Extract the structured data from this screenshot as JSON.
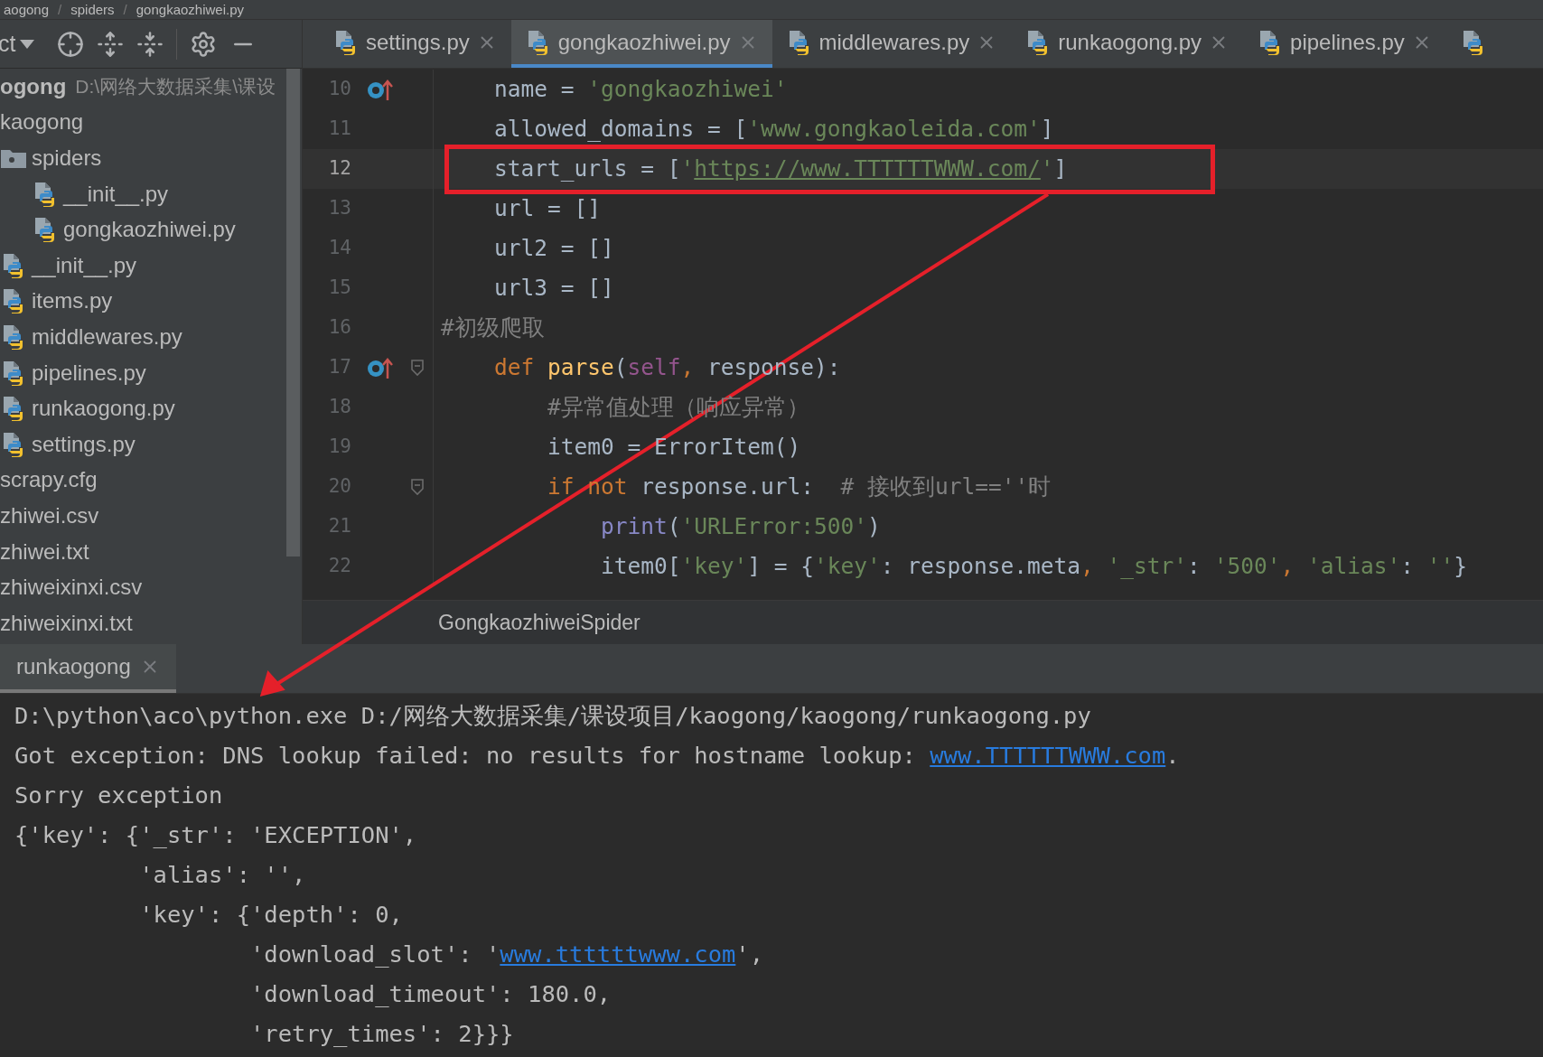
{
  "breadcrumb": {
    "separator": "/",
    "items": [
      "aogong",
      "spiders",
      "gongkaozhiwei.py"
    ]
  },
  "project_panel": {
    "view_label": "ct",
    "root": {
      "name": "ogong",
      "path": "D:\\网络大数据采集\\课设"
    },
    "tree": [
      {
        "name": "kaogong",
        "children": [
          {
            "name": "spiders",
            "kind": "folder",
            "children": [
              {
                "name": "__init__.py",
                "kind": "python"
              },
              {
                "name": "gongkaozhiwei.py",
                "kind": "python"
              }
            ]
          },
          {
            "name": "__init__.py",
            "kind": "python"
          },
          {
            "name": "items.py",
            "kind": "python"
          },
          {
            "name": "middlewares.py",
            "kind": "python"
          },
          {
            "name": "pipelines.py",
            "kind": "python"
          },
          {
            "name": "runkaogong.py",
            "kind": "python"
          },
          {
            "name": "settings.py",
            "kind": "python"
          }
        ]
      },
      {
        "name": "scrapy.cfg"
      },
      {
        "name": "zhiwei.csv"
      },
      {
        "name": "zhiwei.txt"
      },
      {
        "name": "zhiweixinxi.csv"
      },
      {
        "name": "zhiweixinxi.txt"
      }
    ]
  },
  "tabs": [
    {
      "label": "settings.py",
      "selected": false
    },
    {
      "label": "gongkaozhiwei.py",
      "selected": true
    },
    {
      "label": "middlewares.py",
      "selected": false
    },
    {
      "label": "runkaogong.py",
      "selected": false
    },
    {
      "label": "pipelines.py",
      "selected": false
    }
  ],
  "editor": {
    "lines": [
      {
        "number": "10",
        "current": false,
        "override": true,
        "fold": false,
        "tokens": [
          {
            "kind": "plain",
            "text": "    name = "
          },
          {
            "kind": "string",
            "text": "'gongkaozhiwei'"
          }
        ]
      },
      {
        "number": "11",
        "current": false,
        "override": false,
        "fold": false,
        "tokens": [
          {
            "kind": "plain",
            "text": "    allowed_domains = ["
          },
          {
            "kind": "string",
            "text": "'www.gongkaoleida.com'"
          },
          {
            "kind": "plain",
            "text": "]"
          }
        ]
      },
      {
        "number": "12",
        "current": true,
        "override": false,
        "fold": false,
        "tokens": [
          {
            "kind": "plain",
            "text": "    start_urls = ["
          },
          {
            "kind": "string",
            "text": "'"
          },
          {
            "kind": "url",
            "text": "https://www.TTTTTTWWW.com/"
          },
          {
            "kind": "string",
            "text": "'"
          },
          {
            "kind": "plain",
            "text": "]"
          }
        ]
      },
      {
        "number": "13",
        "current": false,
        "override": false,
        "fold": false,
        "tokens": [
          {
            "kind": "plain",
            "text": "    url = []"
          }
        ]
      },
      {
        "number": "14",
        "current": false,
        "override": false,
        "fold": false,
        "tokens": [
          {
            "kind": "plain",
            "text": "    url2 = []"
          }
        ]
      },
      {
        "number": "15",
        "current": false,
        "override": false,
        "fold": false,
        "tokens": [
          {
            "kind": "plain",
            "text": "    url3 = []"
          }
        ]
      },
      {
        "number": "16",
        "current": false,
        "override": false,
        "fold": false,
        "tokens": [
          {
            "kind": "comment",
            "text": "#初级爬取"
          }
        ]
      },
      {
        "number": "17",
        "current": false,
        "override": true,
        "fold": true,
        "tokens": [
          {
            "kind": "keyword",
            "text": "    def"
          },
          {
            "kind": "func",
            "text": " parse"
          },
          {
            "kind": "plain",
            "text": "("
          },
          {
            "kind": "self",
            "text": "self"
          },
          {
            "kind": "keyword",
            "text": ", "
          },
          {
            "kind": "plain",
            "text": "response):"
          }
        ]
      },
      {
        "number": "18",
        "current": false,
        "override": false,
        "fold": false,
        "tokens": [
          {
            "kind": "comment",
            "text": "        #异常值处理（响应异常）"
          }
        ]
      },
      {
        "number": "19",
        "current": false,
        "override": false,
        "fold": false,
        "tokens": [
          {
            "kind": "plain",
            "text": "        item0 = ErrorItem()"
          }
        ]
      },
      {
        "number": "20",
        "current": false,
        "override": false,
        "fold": true,
        "tokens": [
          {
            "kind": "keyword",
            "text": "        if not"
          },
          {
            "kind": "plain",
            "text": " response.url:  "
          },
          {
            "kind": "comment",
            "text": "# 接收到url==''时"
          }
        ]
      },
      {
        "number": "21",
        "current": false,
        "override": false,
        "fold": false,
        "tokens": [
          {
            "kind": "builtin",
            "text": "            print"
          },
          {
            "kind": "plain",
            "text": "("
          },
          {
            "kind": "string",
            "text": "'URLError:500'"
          },
          {
            "kind": "plain",
            "text": ")"
          }
        ]
      },
      {
        "number": "22",
        "current": false,
        "override": false,
        "fold": false,
        "tokens": [
          {
            "kind": "plain",
            "text": "            item0["
          },
          {
            "kind": "string",
            "text": "'key'"
          },
          {
            "kind": "plain",
            "text": "] = {"
          },
          {
            "kind": "string",
            "text": "'key'"
          },
          {
            "kind": "plain",
            "text": ": response.meta"
          },
          {
            "kind": "keyword",
            "text": ", "
          },
          {
            "kind": "string",
            "text": "'_str'"
          },
          {
            "kind": "plain",
            "text": ": "
          },
          {
            "kind": "string",
            "text": "'500'"
          },
          {
            "kind": "keyword",
            "text": ", "
          },
          {
            "kind": "string",
            "text": "'alias'"
          },
          {
            "kind": "plain",
            "text": ": "
          },
          {
            "kind": "string",
            "text": "''"
          },
          {
            "kind": "plain",
            "text": "}"
          }
        ]
      }
    ]
  },
  "structure_breadcrumb": "GongkaozhiweiSpider",
  "run_panel": {
    "tab": "runkaogong",
    "lines": [
      [
        {
          "kind": "text",
          "text": "D:\\python\\aco\\python.exe D:/网络大数据采集/课设项目/kaogong/kaogong/runkaogong.py"
        }
      ],
      [
        {
          "kind": "text",
          "text": "Got exception: DNS lookup failed: no results for hostname lookup: "
        },
        {
          "kind": "link",
          "text": "www.TTTTTTWWW.com"
        },
        {
          "kind": "text",
          "text": "."
        }
      ],
      [
        {
          "kind": "text",
          "text": "Sorry exception"
        }
      ],
      [
        {
          "kind": "text",
          "text": "{'key': {'_str': 'EXCEPTION',"
        }
      ],
      [
        {
          "kind": "text",
          "text": "         'alias': '',"
        }
      ],
      [
        {
          "kind": "text",
          "text": "         'key': {'depth': 0,"
        }
      ],
      [
        {
          "kind": "text",
          "text": "                 'download_slot': '"
        },
        {
          "kind": "link",
          "text": "www.ttttttwww.com"
        },
        {
          "kind": "text",
          "text": "',"
        }
      ],
      [
        {
          "kind": "text",
          "text": "                 'download_timeout': 180.0,"
        }
      ],
      [
        {
          "kind": "text",
          "text": "                 'retry_times': 2}}}"
        }
      ]
    ]
  }
}
